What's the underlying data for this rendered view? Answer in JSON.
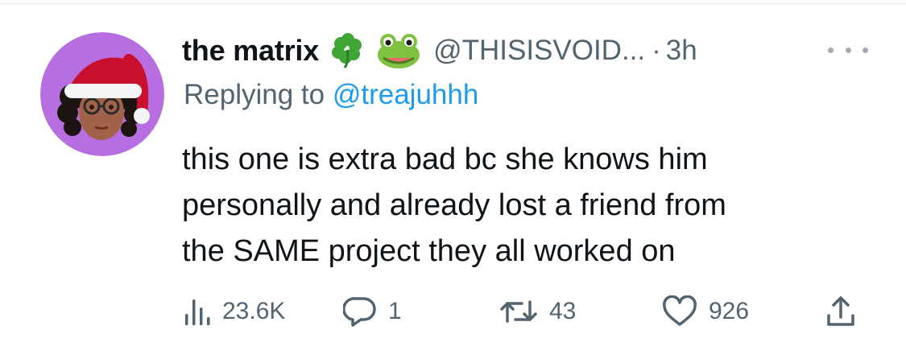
{
  "tweet": {
    "display_name": "the matrix",
    "name_emojis": [
      "four-leaf-clover",
      "frog-face"
    ],
    "handle": "@THISISVOID...",
    "separator": "·",
    "time": "3h",
    "replying_prefix": "Replying to",
    "replying_to": "@treajuhhh",
    "text_lines": [
      "this one is extra bad bc she knows him",
      "personally and already lost a friend from",
      "the SAME project they all worked on"
    ]
  },
  "actions": {
    "views": "23.6K",
    "replies": "1",
    "retweets": "43",
    "likes": "926"
  },
  "icons": {
    "views": "views-bar-chart-icon",
    "reply": "reply-bubble-icon",
    "retweet": "retweet-icon",
    "like": "heart-icon",
    "share": "share-icon",
    "more": "more-dots-icon"
  },
  "colors": {
    "text": "#0f1419",
    "secondary": "#536471",
    "link": "#1d9bf0",
    "avatar_bg": "#b76ee0"
  }
}
